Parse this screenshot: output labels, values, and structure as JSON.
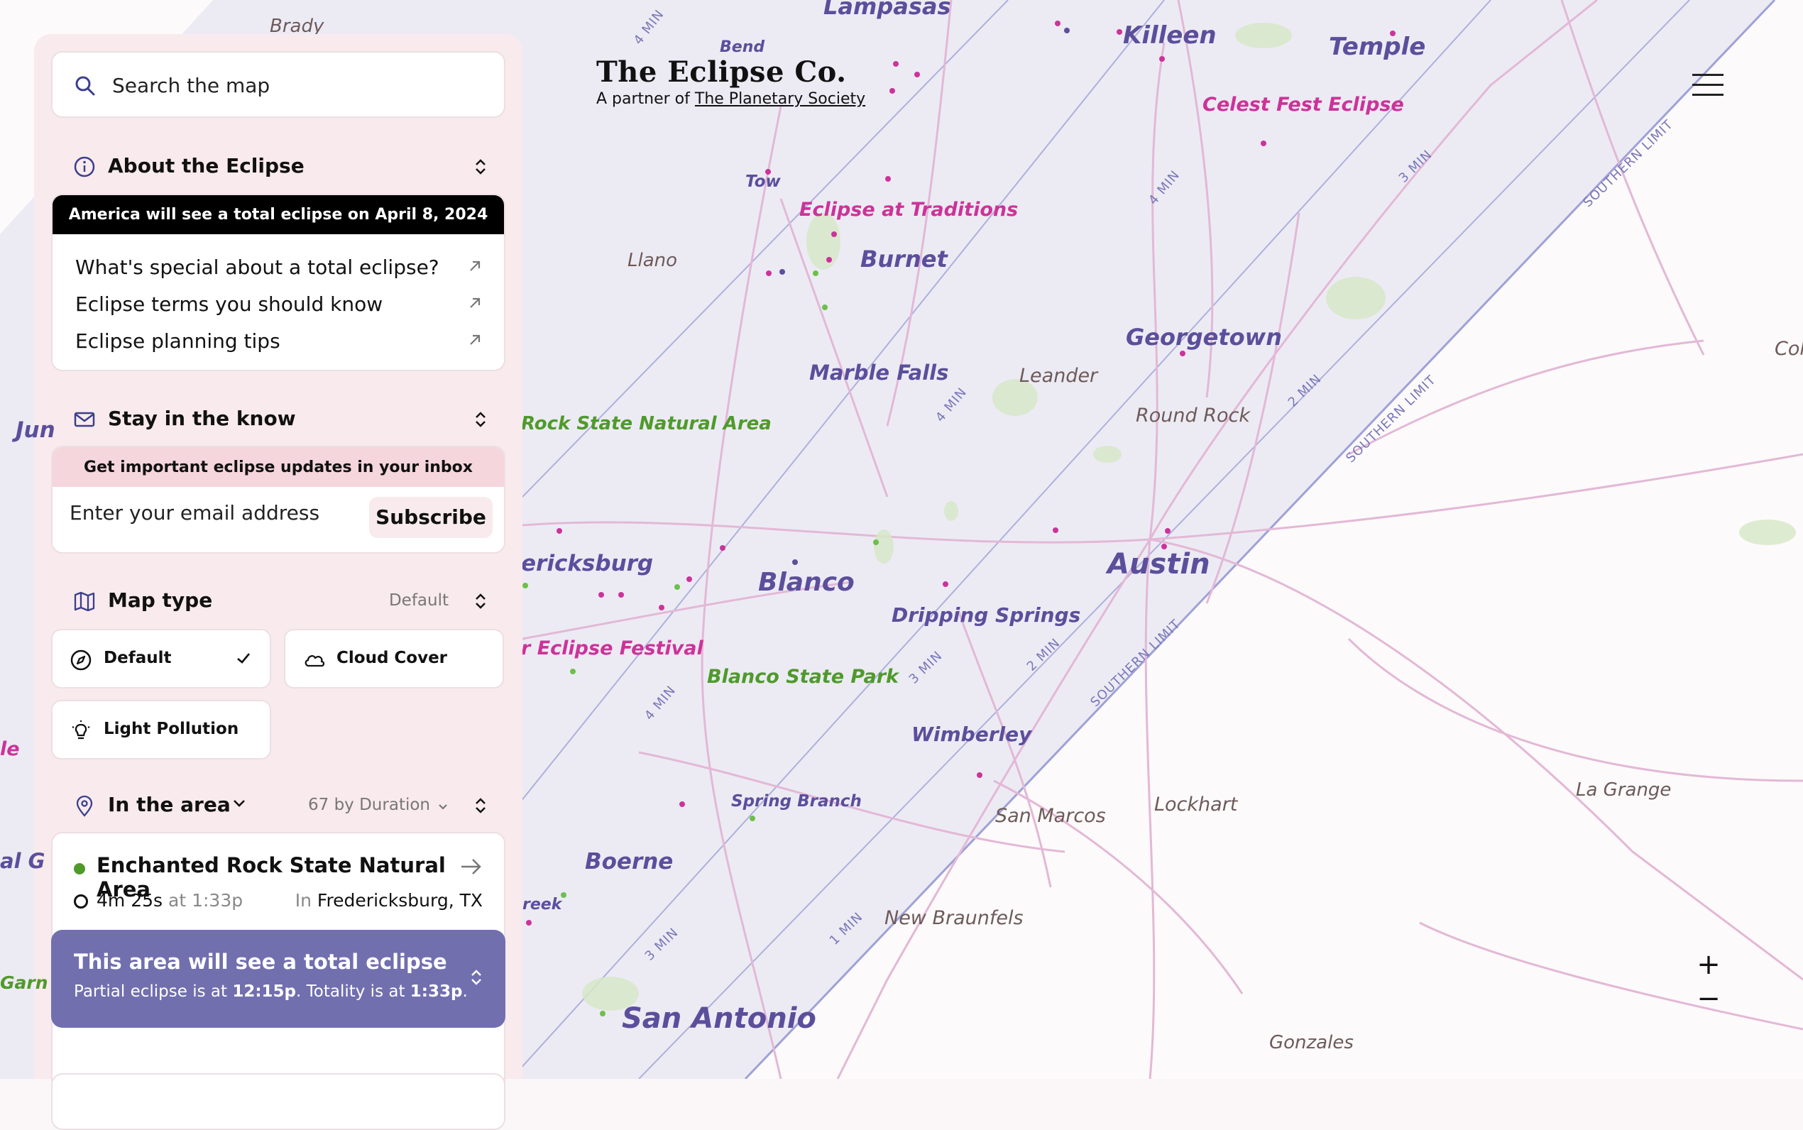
{
  "brand": {
    "title": "The Eclipse Co.",
    "subtitle_prefix": "A partner of",
    "partner_link": "The Planetary Society"
  },
  "search": {
    "placeholder": "Search the map",
    "icon": "search-icon"
  },
  "about": {
    "title": "About the Eclipse",
    "banner": "America will see a total eclipse on April 8, 2024",
    "links": [
      "What's special about a total eclipse?",
      "Eclipse terms you should know",
      "Eclipse planning tips"
    ]
  },
  "newsletter": {
    "title": "Stay in the know",
    "banner": "Get important eclipse updates in your inbox",
    "email_placeholder": "Enter your email address",
    "subscribe_label": "Subscribe"
  },
  "map_type": {
    "title": "Map type",
    "selected": "Default",
    "options": [
      "Default",
      "Cloud Cover",
      "Light Pollution"
    ]
  },
  "area": {
    "title": "In the area",
    "sort_text": "67 by Duration",
    "places": [
      {
        "name": "Enchanted Rock State Natural Area",
        "duration": "4m 25s",
        "at": "at",
        "time": "1:33p",
        "in": "In",
        "location": "Fredericksburg, TX"
      }
    ]
  },
  "total_banner": {
    "heading": "This area will see a total eclipse",
    "partial_label": "Partial eclipse is at",
    "partial_time": "12:15p",
    "totality_label": "Totality is at",
    "totality_time": "1:33p"
  },
  "zoom": {
    "in": "+",
    "out": "−"
  },
  "map_labels": {
    "cities": [
      "Killeen",
      "Temple",
      "Burnet",
      "Georgetown",
      "Marble Falls",
      "Blanco",
      "Austin",
      "Dripping Springs",
      "Wimberley",
      "Boerne",
      "San Antonio",
      "Lampasas"
    ],
    "towns": [
      "Brady",
      "Bend",
      "Tow",
      "Llano",
      "Leander",
      "Round Rock",
      "San Marcos",
      "Lockhart",
      "La Grange",
      "New Braunfels",
      "Gonzales",
      "Col",
      "Jun"
    ],
    "parks": [
      "Rock State Natural Area",
      "Blanco State Park",
      "Spring Branch",
      "Garn"
    ],
    "events": [
      "Celest Fest Eclipse",
      "Eclipse at Traditions",
      "r Eclipse Festival",
      "le"
    ],
    "fragments": [
      "ericksburg",
      "reek",
      "al G"
    ],
    "durations": [
      "4 MIN",
      "3 MIN",
      "2 MIN",
      "1 MIN",
      "SOUTHERN LIMIT"
    ]
  },
  "colors": {
    "totality_band": "#ecebf4",
    "panel_bg": "#f9eaed",
    "accent_purple": "#716fae",
    "city_label": "#5b4f9c",
    "event_label": "#cc3399",
    "park_label": "#4f9a2b"
  }
}
